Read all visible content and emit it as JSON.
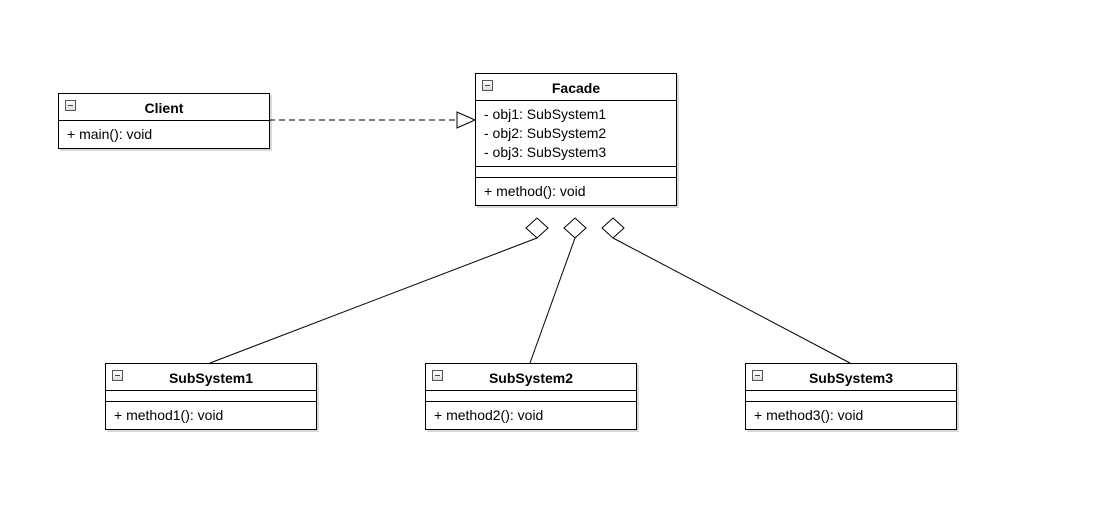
{
  "classes": {
    "client": {
      "name": "Client",
      "methods": [
        "+ main(): void"
      ]
    },
    "facade": {
      "name": "Facade",
      "attributes": [
        "- obj1: SubSystem1",
        "- obj2: SubSystem2",
        "- obj3: SubSystem3"
      ],
      "methods": [
        "+ method(): void"
      ]
    },
    "sub1": {
      "name": "SubSystem1",
      "methods": [
        "+ method1(): void"
      ]
    },
    "sub2": {
      "name": "SubSystem2",
      "methods": [
        "+ method2(): void"
      ]
    },
    "sub3": {
      "name": "SubSystem3",
      "methods": [
        "+ method3(): void"
      ]
    }
  },
  "relationships": [
    {
      "from": "client",
      "to": "facade",
      "type": "dependency"
    },
    {
      "from": "facade",
      "to": "sub1",
      "type": "aggregation"
    },
    {
      "from": "facade",
      "to": "sub2",
      "type": "aggregation"
    },
    {
      "from": "facade",
      "to": "sub3",
      "type": "aggregation"
    }
  ]
}
